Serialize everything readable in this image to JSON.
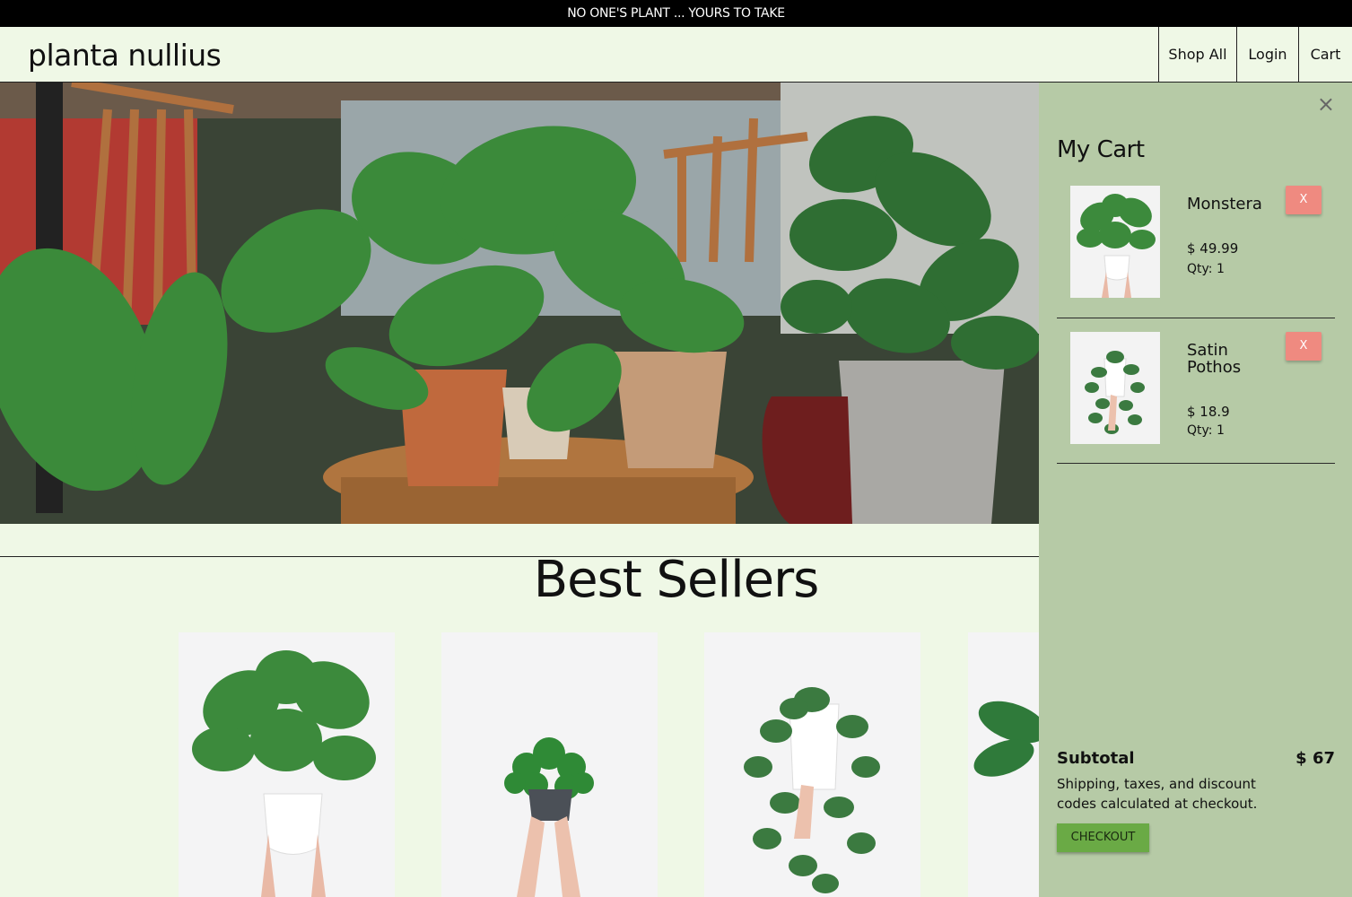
{
  "announcement": "NO ONE'S PLANT ... YOURS TO TAKE",
  "brand": "planta nullius",
  "nav": {
    "shop_all": "Shop All",
    "login": "Login",
    "cart": "Cart"
  },
  "section_title": "Best Sellers",
  "cart": {
    "title": "My Cart",
    "close_icon": "×",
    "items": [
      {
        "name": "Monstera",
        "price": "$ 49.99",
        "qty": "Qty: 1",
        "remove": "X"
      },
      {
        "name": "Satin Pothos",
        "price": "$ 18.9",
        "qty": "Qty: 1",
        "remove": "X"
      }
    ],
    "subtotal_label": "Subtotal",
    "subtotal_value": "$ 67",
    "note": "Shipping, taxes, and discount codes calculated at checkout.",
    "checkout": "CHECKOUT"
  }
}
